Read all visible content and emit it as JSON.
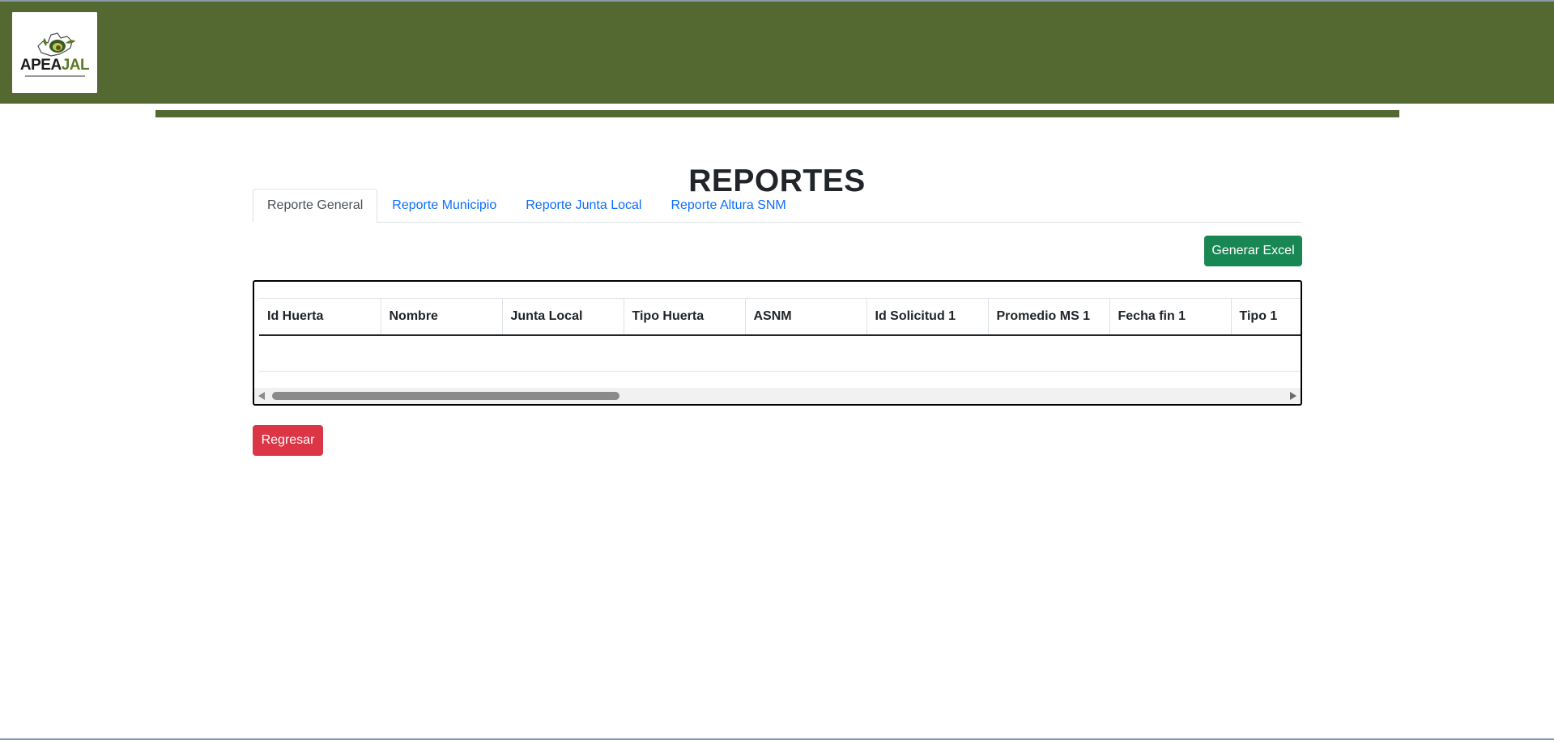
{
  "header": {
    "logo": {
      "primary": "APEA",
      "accent": "JAL",
      "accent_color": "#5b7a25"
    },
    "background_color": "#536931"
  },
  "page": {
    "title": "REPORTES"
  },
  "tabs": [
    {
      "label": "Reporte General",
      "active": true
    },
    {
      "label": "Reporte Municipio",
      "active": false
    },
    {
      "label": "Reporte Junta Local",
      "active": false
    },
    {
      "label": "Reporte Altura SNM",
      "active": false
    }
  ],
  "actions": {
    "excel_label": "Generar Excel",
    "excel_color": "#198754",
    "back_label": "Regresar",
    "back_color": "#dc3545"
  },
  "table": {
    "columns": [
      "Id Huerta",
      "Nombre",
      "Junta Local",
      "Tipo Huerta",
      "ASNM",
      "Id Solicitud 1",
      "Promedio MS 1",
      "Fecha fin 1",
      "Tipo 1"
    ],
    "rows": []
  },
  "icons": {
    "logo": "avocado-map-logo-icon",
    "scroll_left": "arrow-left-icon",
    "scroll_right": "arrow-right-icon"
  }
}
